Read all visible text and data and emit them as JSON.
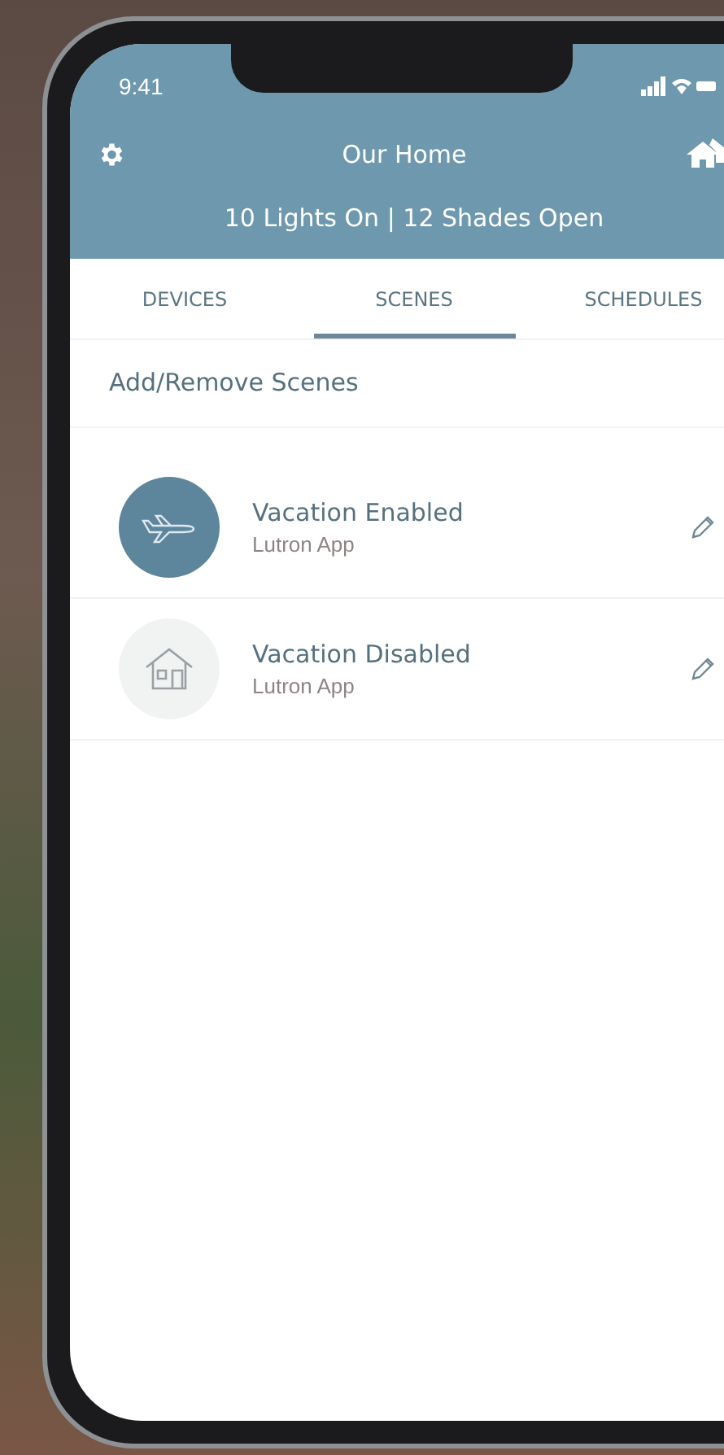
{
  "status_bar": {
    "time": "9:41"
  },
  "header": {
    "title": "Our Home",
    "summary": "10 Lights On | 12 Shades Open"
  },
  "tabs": [
    {
      "label": "DEVICES",
      "selected": false
    },
    {
      "label": "SCENES",
      "selected": true
    },
    {
      "label": "SCHEDULES",
      "selected": false
    }
  ],
  "add_remove": "Add/Remove Scenes",
  "scenes": [
    {
      "kind": "away",
      "name": "Vacation Enabled",
      "source": "Lutron App",
      "active": true
    },
    {
      "kind": "home",
      "name": "Vacation Disabled",
      "source": "Lutron App",
      "active": false
    }
  ]
}
